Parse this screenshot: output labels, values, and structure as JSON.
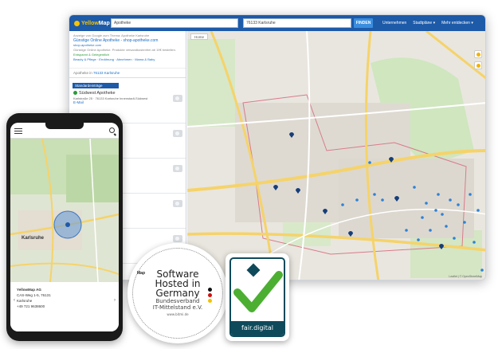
{
  "desktop": {
    "brand": {
      "part1": "Yellow",
      "part2": "Map"
    },
    "search": {
      "what_value": "Apotheke",
      "where_value": "76133 Karlsruhe",
      "button_label": "FINDEN"
    },
    "nav": [
      "Unternehmen",
      "Stadtpläne ▾",
      "Mehr entdecken ▾"
    ],
    "ad": {
      "header": "Anzeige von Google zum Thema: Apotheke Karlsruhe",
      "title": "Günstige Online Apotheke - shop-apotheke.com",
      "link": "shop-apotheke.com",
      "text": "Günstige Online Apotheke. Produkte versandkostenfrei ab 19€ bestellen.",
      "green": "Entspannt & Gelegentlich",
      "links": [
        "Beauty & Pflege",
        "Ernährung",
        "Abnehmen",
        "Mama & Baby"
      ]
    },
    "results_prefix": "Apotheke in",
    "results_location": "76133 Karlsruhe",
    "entries_tab": "Standardeinträge",
    "listings": [
      {
        "name": "Südwest Apotheke",
        "addr": "Karlstraße 25 · 76133 Karlsruhe Innenstadt-Südwest",
        "mail": "E-Mail"
      },
      {
        "name": "...am St. Vinzenz",
        "addr": "...e",
        "mail": ""
      },
      {
        "name": "...cher Tor",
        "addr": "...33 Karlsruhe",
        "mail": "E-Mail"
      },
      {
        "name": "",
        "addr": "...Karlsruhe",
        "mail": "E-Mail"
      },
      {
        "name": "",
        "addr": "...Karlsruhe",
        "mail": "E-Mail"
      }
    ],
    "home_tab": "Home",
    "map_credit": "Leaflet | © OpenStreetMap"
  },
  "phone": {
    "city_label": "Karlsruhe",
    "business": "YellowMap AG",
    "street": "CAS-Weg 1-5, 76131",
    "city": "Karlsruhe",
    "phone": "+49 721 9638600"
  },
  "badges": {
    "seal": {
      "line1": "Software",
      "line2": "Hosted in",
      "line3": "Germany",
      "line4": "Bundesverband",
      "line5": "IT-Mittelstand e.V.",
      "url": "www.bitmi.de"
    },
    "fair": {
      "label": "fair.digital"
    }
  },
  "colors": {
    "brand_blue": "#1d5aa8",
    "brand_yellow": "#f7c300",
    "pin": "#163e78",
    "map_road": "#f5d36a",
    "fair_teal": "#0e4a5a",
    "fair_green": "#4caf32"
  }
}
